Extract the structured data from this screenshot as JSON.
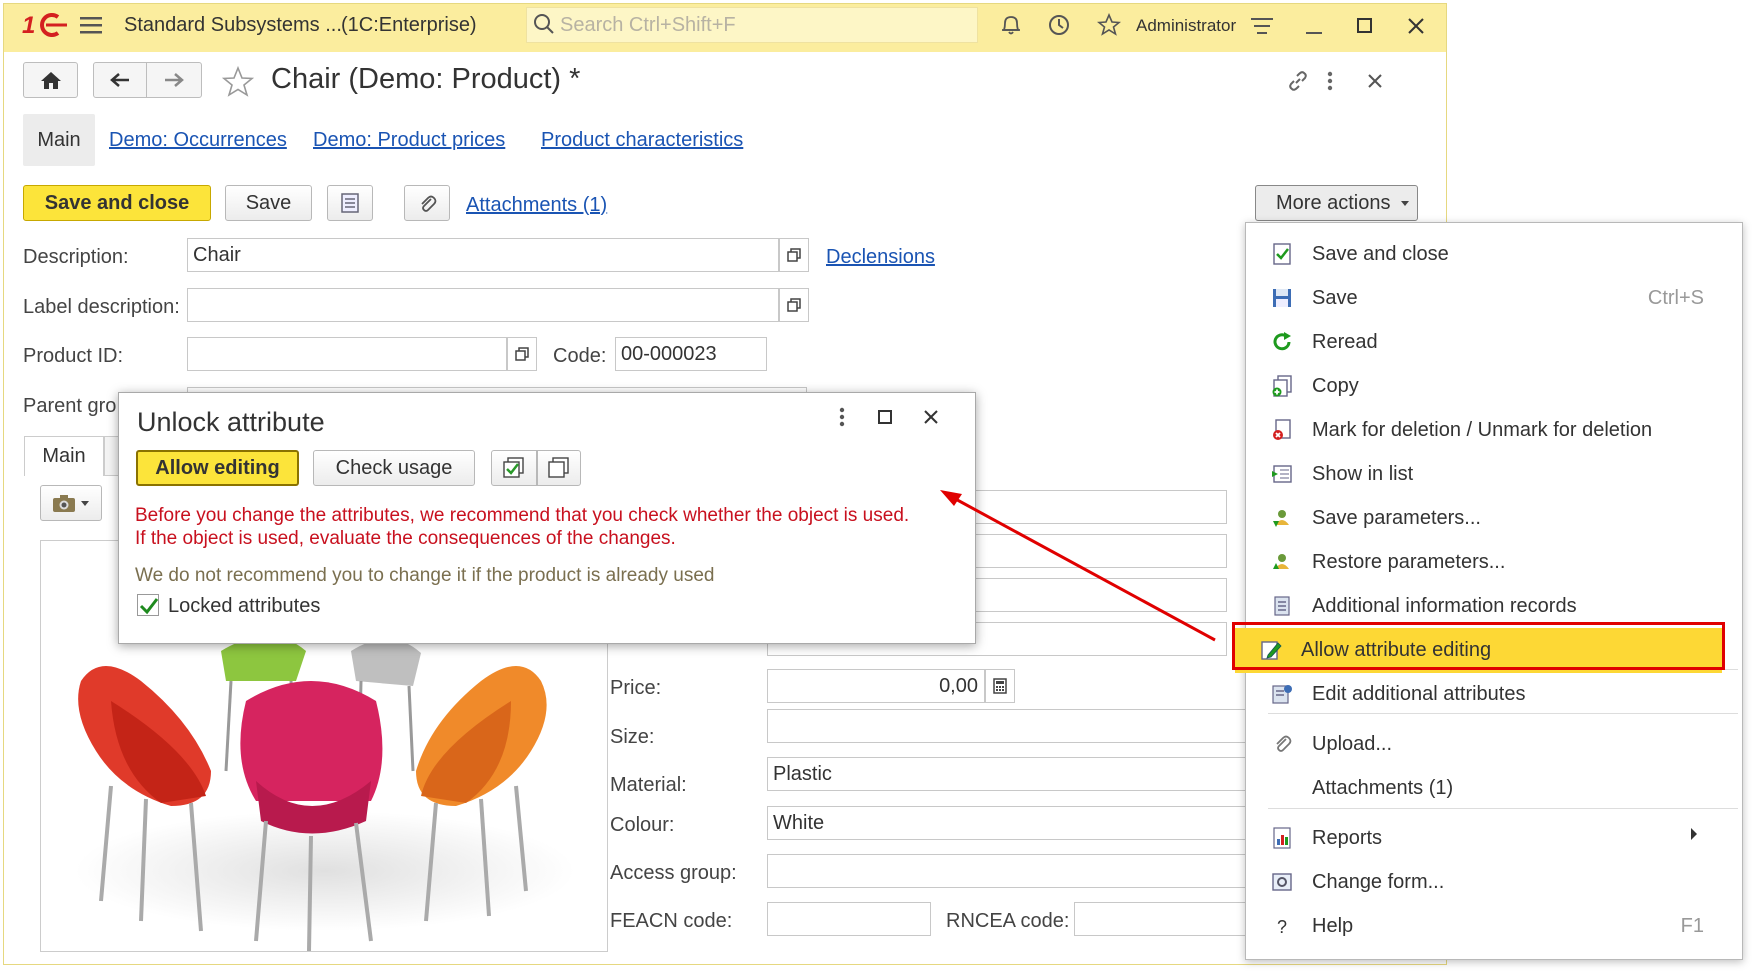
{
  "titlebar": {
    "app_title": "Standard Subsystems ...",
    "platform": "(1C:Enterprise)",
    "search_placeholder": "Search Ctrl+Shift+F",
    "user": "Administrator"
  },
  "form": {
    "title": "Chair (Demo: Product) *",
    "tabs": [
      "Main",
      "Demo: Occurrences",
      "Demo: Product prices",
      "Product characteristics"
    ],
    "buttons": {
      "save_close": "Save and close",
      "save": "Save",
      "attachments": "Attachments (1)",
      "more_actions": "More actions"
    },
    "fields": {
      "description_label": "Description:",
      "description_value": "Chair",
      "declensions": "Declensions",
      "label_description_label": "Label description:",
      "label_description_value": "",
      "product_id_label": "Product ID:",
      "product_id_value": "",
      "code_label": "Code:",
      "code_value": "00-000023",
      "parent_group_label": "Parent gro",
      "inner_tab": "Main",
      "price_label": "Price:",
      "price_value": "0,00",
      "size_label": "Size:",
      "size_value": "",
      "material_label": "Material:",
      "material_value": "Plastic",
      "colour_label": "Colour:",
      "colour_value": "White",
      "access_group_label": "Access group:",
      "access_group_value": "",
      "feacn_label": "FEACN code:",
      "feacn_value": "",
      "rncea_label": "RNCEA code:",
      "rncea_value": ""
    }
  },
  "dialog": {
    "title": "Unlock attribute",
    "allow_editing": "Allow editing",
    "check_usage": "Check usage",
    "warning_line1": "Before you change the attributes, we recommend that you check whether the object is used.",
    "warning_line2": "If the object is used, evaluate the consequences of the changes.",
    "note": "We do not recommend you to change it if the product is already used",
    "locked_attributes_label": "Locked attributes",
    "locked_attributes_checked": true
  },
  "menu": {
    "items": [
      {
        "label": "Save and close",
        "icon": "save-close-icon",
        "shortcut": ""
      },
      {
        "label": "Save",
        "icon": "floppy-icon",
        "shortcut": "Ctrl+S"
      },
      {
        "label": "Reread",
        "icon": "refresh-icon",
        "shortcut": ""
      },
      {
        "label": "Copy",
        "icon": "copy-icon",
        "shortcut": ""
      },
      {
        "label": "Mark for deletion / Unmark for deletion",
        "icon": "delete-mark-icon",
        "shortcut": ""
      },
      {
        "label": "Show in list",
        "icon": "show-in-list-icon",
        "shortcut": ""
      },
      {
        "label": "Save parameters...",
        "icon": "save-params-icon",
        "shortcut": ""
      },
      {
        "label": "Restore parameters...",
        "icon": "restore-params-icon",
        "shortcut": ""
      },
      {
        "label": "Additional information records",
        "icon": "info-records-icon",
        "shortcut": ""
      },
      {
        "label": "Allow attribute editing",
        "icon": "edit-pencil-icon",
        "shortcut": ""
      },
      {
        "label": "Edit additional attributes",
        "icon": "edit-attributes-icon",
        "shortcut": ""
      },
      {
        "label": "Upload...",
        "icon": "paperclip-icon",
        "shortcut": ""
      },
      {
        "label": "Attachments (1)",
        "icon": "",
        "shortcut": ""
      },
      {
        "label": "Reports",
        "icon": "reports-icon",
        "shortcut": ""
      },
      {
        "label": "Change form...",
        "icon": "change-form-icon",
        "shortcut": ""
      },
      {
        "label": "Help",
        "icon": "help-icon",
        "shortcut": "F1"
      }
    ]
  },
  "colors": {
    "titlebar_bg": "#fbed9e",
    "primary_button": "#fce43a",
    "highlight": "#fdd835",
    "annotation_red": "#e00000",
    "link": "#1a54b3",
    "warning_text": "#c8101e"
  }
}
